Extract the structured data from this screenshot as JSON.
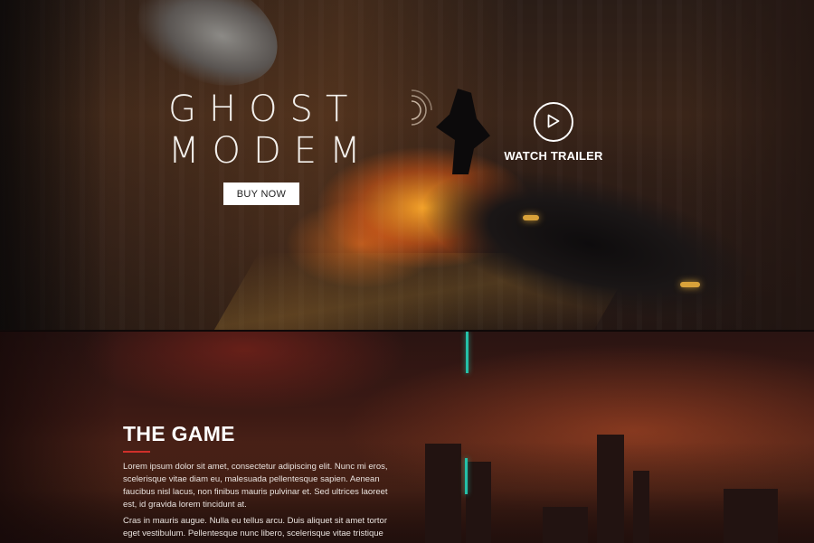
{
  "hero": {
    "logo_line1": "GHOST",
    "logo_line2": "MODEM",
    "buy_button": "BUY NOW",
    "watch_trailer": "WATCH TRAILER"
  },
  "game": {
    "title": "THE GAME",
    "paragraph1": "Lorem ipsum dolor sit amet, consectetur adipiscing elit. Nunc mi eros, scelerisque vitae diam eu, malesuada pellentesque sapien. Aenean faucibus nisl lacus, non finibus mauris pulvinar et. Sed ultrices laoreet est, id gravida lorem tincidunt at.",
    "paragraph2": "Cras in mauris augue. Nulla eu tellus arcu. Duis aliquet sit amet tortor eget vestibulum. Pellentesque nunc libero, scelerisque vitae tristique"
  },
  "colors": {
    "accent_rule": "#d0302a",
    "button_bg": "#ffffff",
    "neon": "#25c0a8"
  },
  "icons": {
    "play": "play-icon"
  }
}
